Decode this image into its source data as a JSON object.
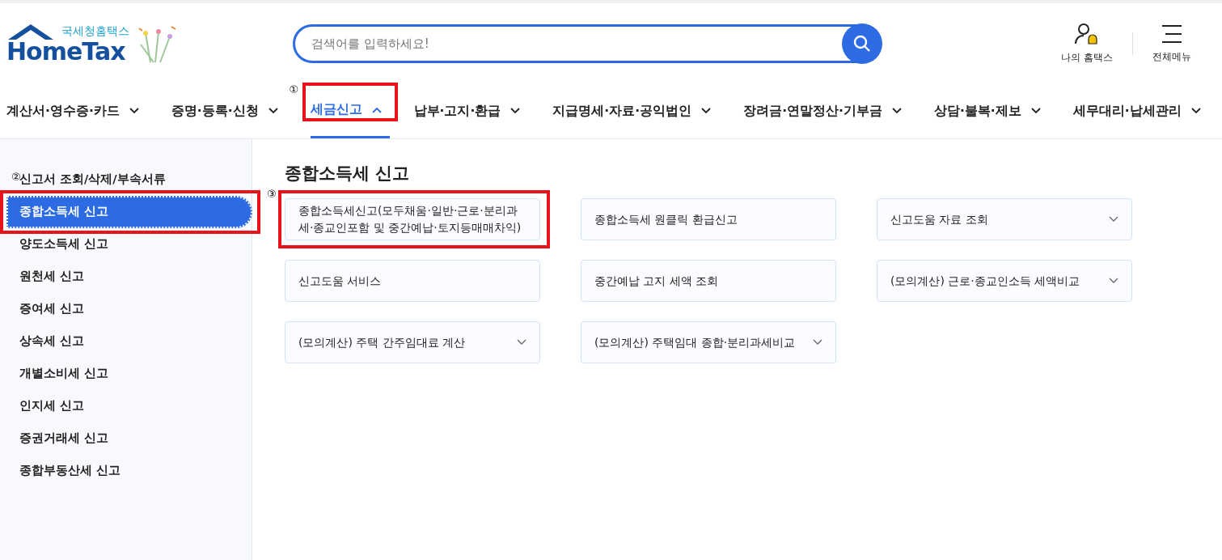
{
  "header": {
    "logo": {
      "subtitle": "국세청홈택스",
      "title": "HomeTax"
    },
    "search": {
      "placeholder": "검색어를 입력하세요!"
    },
    "utilities": [
      {
        "kind": "user",
        "label": "나의 홈택스"
      },
      {
        "kind": "menu",
        "label": "전체메뉴"
      }
    ]
  },
  "nav": {
    "items": [
      {
        "label": "계산서·영수증·카드",
        "selected": false
      },
      {
        "label": "증명·등록·신청",
        "selected": false
      },
      {
        "label": "세금신고",
        "selected": true,
        "annotation": "①"
      },
      {
        "label": "납부·고지·환급",
        "selected": false
      },
      {
        "label": "지급명세·자료·공익법인",
        "selected": false
      },
      {
        "label": "장려금·연말정산·기부금",
        "selected": false
      },
      {
        "label": "상담·불복·제보",
        "selected": false
      },
      {
        "label": "세무대리·납세관리",
        "selected": false
      }
    ]
  },
  "sidebar": {
    "items": [
      {
        "label": "신고서 조회/삭제/부속서류",
        "selected": false
      },
      {
        "label": "종합소득세 신고",
        "selected": true,
        "annotation": "②"
      },
      {
        "label": "양도소득세 신고",
        "selected": false
      },
      {
        "label": "원천세 신고",
        "selected": false
      },
      {
        "label": "증여세 신고",
        "selected": false
      },
      {
        "label": "상속세 신고",
        "selected": false
      },
      {
        "label": "개별소비세 신고",
        "selected": false
      },
      {
        "label": "인지세 신고",
        "selected": false
      },
      {
        "label": "증권거래세 신고",
        "selected": false
      },
      {
        "label": "종합부동산세 신고",
        "selected": false
      }
    ]
  },
  "content": {
    "title": "종합소득세 신고",
    "cards": [
      {
        "label": "종합소득세신고(모두채움·일반·근로·분리과세·종교인포함 및 중간예납·토지등매매차익)",
        "kind": "link",
        "annotation": "③"
      },
      {
        "label": "종합소득세 원클릭 환급신고",
        "kind": "link"
      },
      {
        "label": "신고도움 자료 조회",
        "kind": "dropdown"
      },
      {
        "label": "신고도움 서비스",
        "kind": "link"
      },
      {
        "label": "중간예납 고지 세액 조회",
        "kind": "link"
      },
      {
        "label": "(모의계산) 근로·종교인소득 세액비교",
        "kind": "dropdown"
      },
      {
        "label": "(모의계산) 주택 간주임대료 계산",
        "kind": "dropdown"
      },
      {
        "label": "(모의계산) 주택임대 종합·분리과세비교",
        "kind": "dropdown"
      }
    ]
  }
}
